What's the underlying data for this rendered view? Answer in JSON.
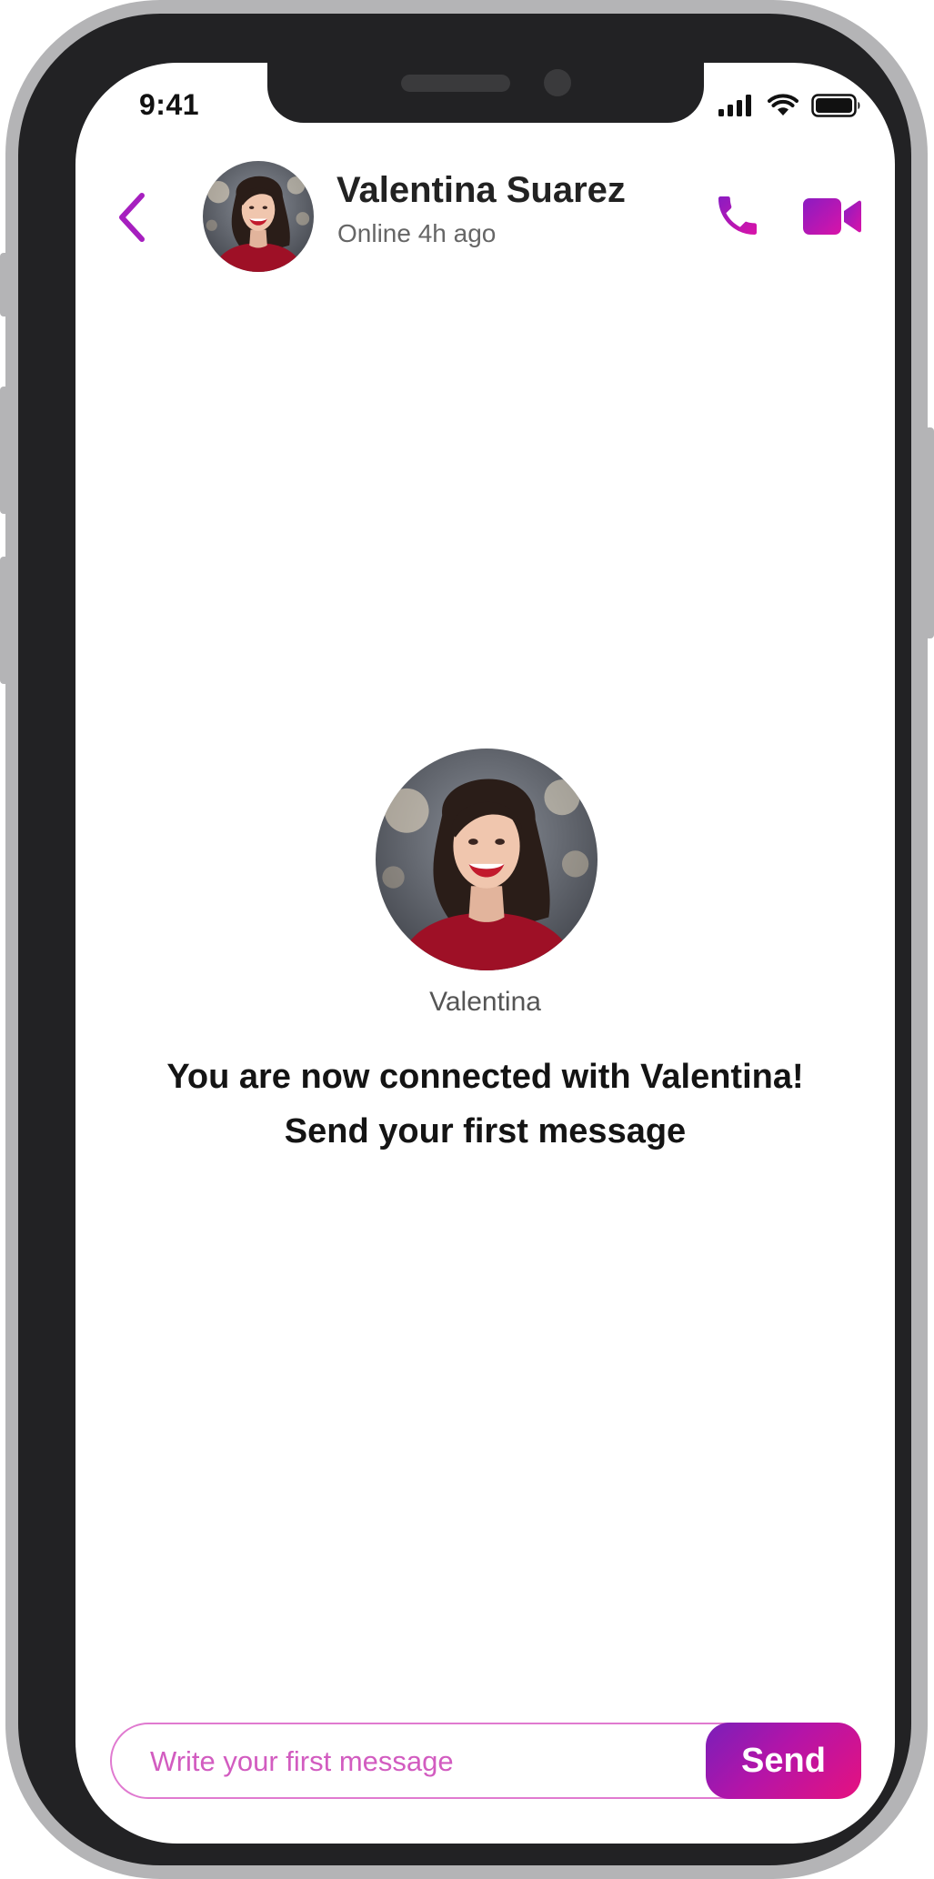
{
  "status_bar": {
    "time": "9:41",
    "icons": [
      "signal-icon",
      "wifi-icon",
      "battery-icon"
    ]
  },
  "header": {
    "back_icon": "chevron-left-icon",
    "contact_name": "Valentina Suarez",
    "contact_status": "Online 4h ago",
    "actions": [
      "phone-icon",
      "video-camera-icon"
    ]
  },
  "profile": {
    "first_name": "Valentina",
    "connected_line1": "You are now connected with Valentina!",
    "connected_line2": "Send your first message"
  },
  "composer": {
    "placeholder": "Write your first message",
    "value": "",
    "send_label": "Send"
  },
  "colors": {
    "accent": "#b515c0",
    "accent_gradient_start": "#7a1fb9",
    "accent_gradient_end": "#e6127f",
    "input_border": "#e07ad0",
    "frame": "#222224"
  }
}
